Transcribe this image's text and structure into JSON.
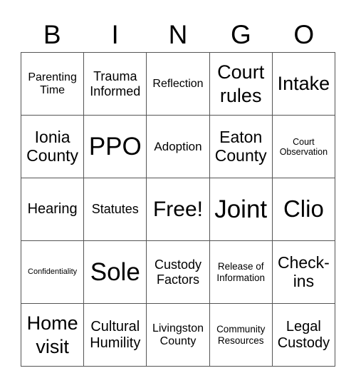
{
  "header": {
    "letters": [
      "B",
      "I",
      "N",
      "G",
      "O"
    ]
  },
  "cells": [
    [
      "Parenting Time",
      "Trauma Informed",
      "Reflection",
      "Court rules",
      "Intake"
    ],
    [
      "Ionia County",
      "PPO",
      "Adoption",
      "Eaton County",
      "Court Observation"
    ],
    [
      "Hearing",
      "Statutes",
      "Free!",
      "Joint",
      "Clio"
    ],
    [
      "Confidentiality",
      "Sole",
      "Custody Factors",
      "Release of Information",
      "Check-ins"
    ],
    [
      "Home visit",
      "Cultural Humility",
      "Livingston County",
      "Community Resources",
      "Legal Custody"
    ]
  ]
}
